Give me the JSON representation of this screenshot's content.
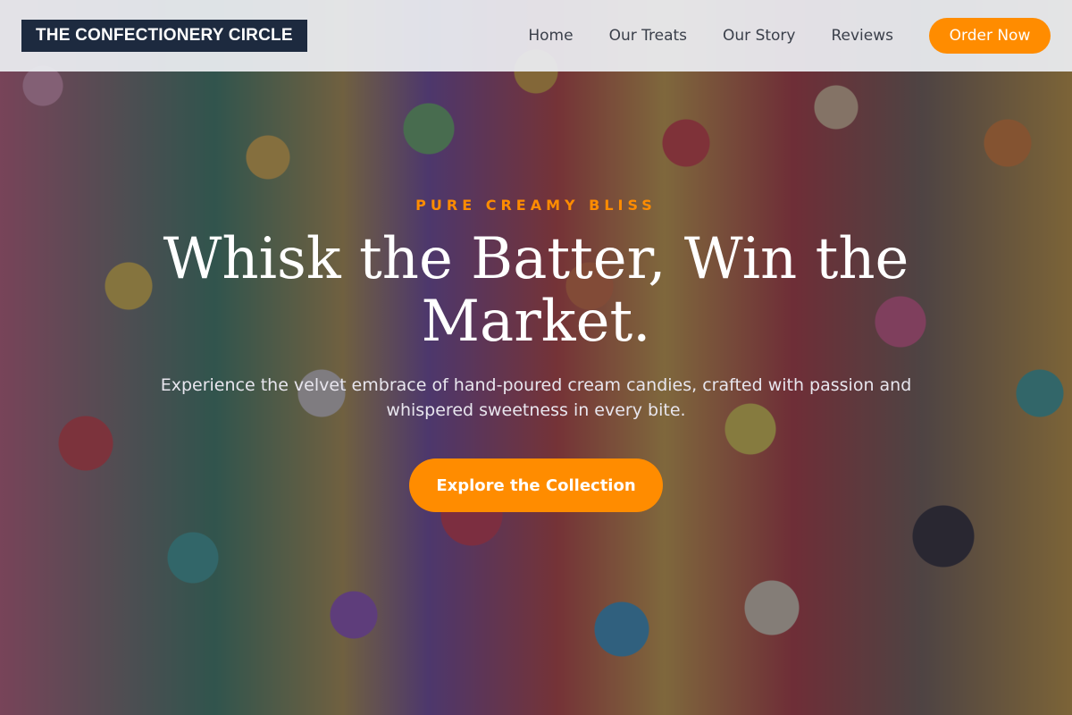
{
  "header": {
    "logo": "THE CONFECTIONERY CIRCLE",
    "nav": [
      {
        "label": "Home"
      },
      {
        "label": "Our Treats"
      },
      {
        "label": "Our Story"
      },
      {
        "label": "Reviews"
      }
    ],
    "order_label": "Order Now"
  },
  "hero": {
    "eyebrow": "PURE CREAMY BLISS",
    "headline": "Whisk the Batter, Win the Market.",
    "subtext": "Experience the velvet embrace of hand-poured cream candies, crafted with passion and whispered sweetness in every bite.",
    "cta_label": "Explore the Collection"
  },
  "colors": {
    "accent": "#ff8c00",
    "logo_bg": "#1d2a3f",
    "header_bg": "#eceef2",
    "text_light": "#ffffff"
  }
}
